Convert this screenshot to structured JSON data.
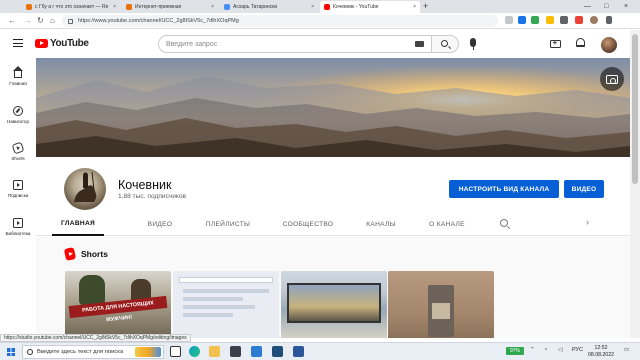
{
  "browser": {
    "tabs": [
      {
        "title": "с Гбу а г что это означает — Re",
        "favicon_color": "#e8710a",
        "active": false
      },
      {
        "title": "Интернет-приемная",
        "favicon_color": "#e8710a",
        "active": false
      },
      {
        "title": "Асхарь Татарински",
        "favicon_color": "#4a8df6",
        "active": false
      },
      {
        "title": "Кочевник - YouTube",
        "favicon_color": "#ff0000",
        "active": true
      }
    ],
    "new_tab_glyph": "+",
    "close_glyph": "×",
    "window_controls": [
      "—",
      "□",
      "×"
    ],
    "nav": {
      "back": "←",
      "forward": "→",
      "reload": "↻",
      "home": "⌂"
    },
    "url": "https://www.youtube.com/channel/UCC_2g8tSkV5c_7dlhXOqPMg"
  },
  "youtube": {
    "logo_text": "YouTube",
    "search_placeholder": "Введите запрос",
    "guide": [
      {
        "label": "Главная",
        "icon": "home-icon"
      },
      {
        "label": "Навигатор",
        "icon": "compass-icon"
      },
      {
        "label": "Shorts",
        "icon": "shorts-icon"
      },
      {
        "label": "Подписки",
        "icon": "subscriptions-icon"
      },
      {
        "label": "Библиотека",
        "icon": "library-icon"
      }
    ]
  },
  "channel": {
    "name": "Кочевник",
    "subscribers": "1,88 тыс. подписчиков",
    "customize_button": "НАСТРОИТЬ ВИД КАНАЛА",
    "video_button": "ВИДЕО",
    "accent_color": "#065fd4",
    "tabs": [
      "ГЛАВНАЯ",
      "ВИДЕО",
      "ПЛЕЙЛИСТЫ",
      "СООБЩЕСТВО",
      "КАНАЛЫ",
      "О КАНАЛЕ"
    ],
    "active_tab": "ГЛАВНАЯ",
    "section_title": "Shorts",
    "thumb1_caption": "РАБОТА ДЛЯ НАСТОЯЩИХ МУЖЧИН!"
  },
  "status_url": "https://studio.youtube.com/channel/UCC_2g8tSkV5c_7dlhXOqPMg/editing/images",
  "taskbar": {
    "search_placeholder": "Введите здесь текст для поиска",
    "battery": "97%",
    "language": "РУС",
    "time": "12:52",
    "date": "08.08.2022"
  }
}
